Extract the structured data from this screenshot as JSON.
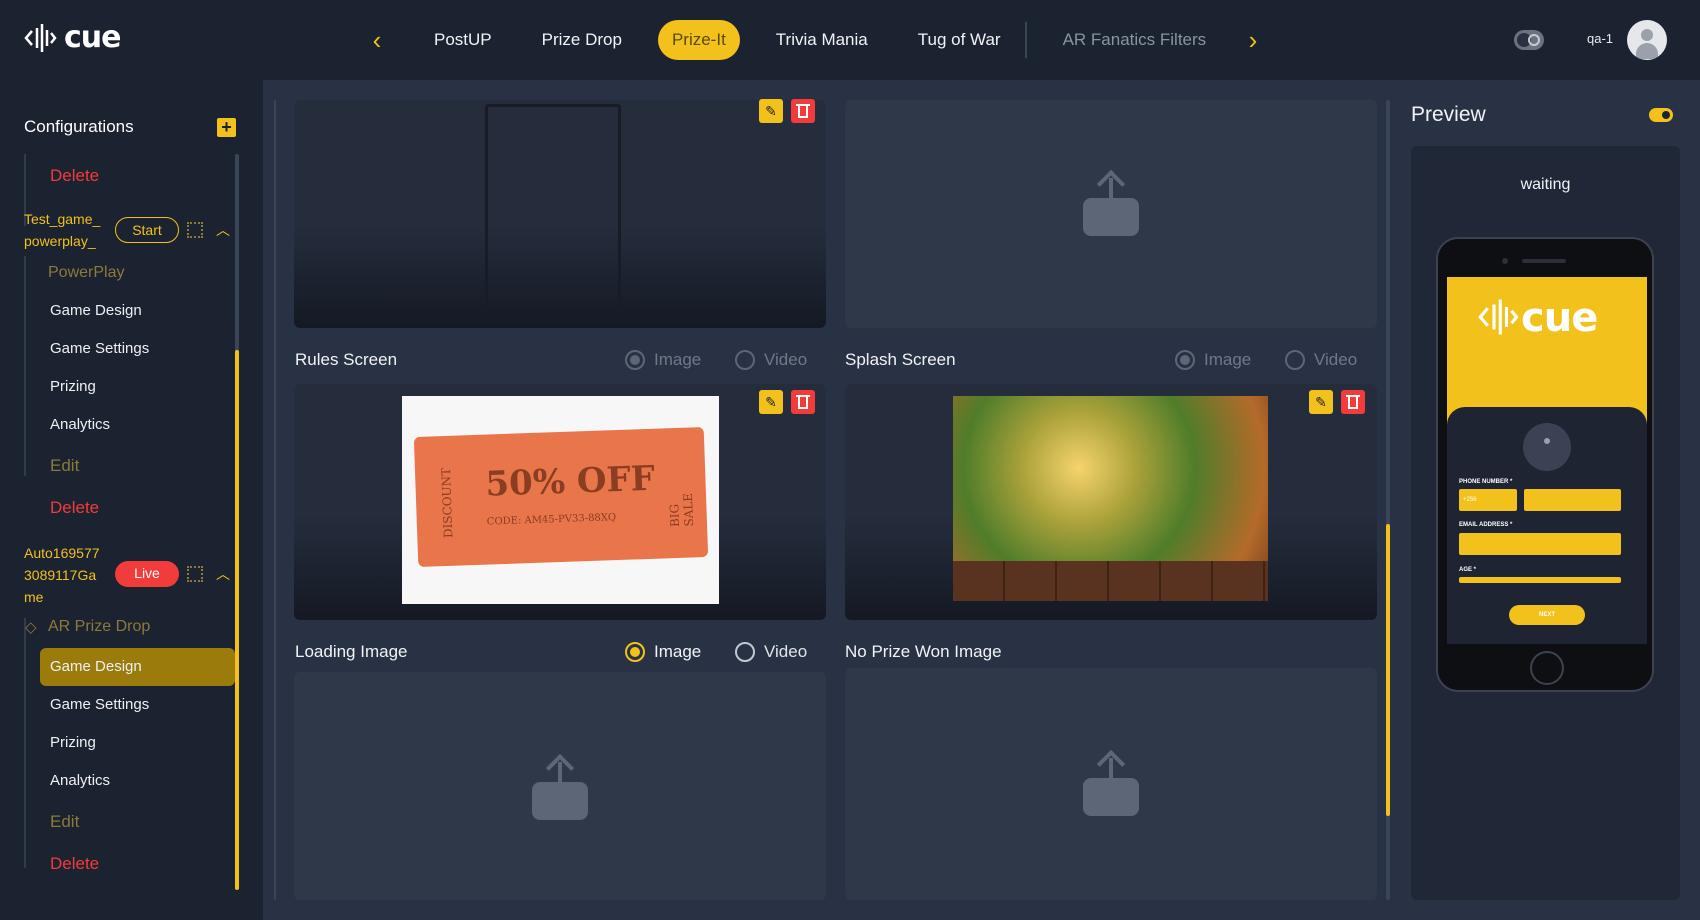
{
  "header": {
    "logo_text": "cue",
    "tabs": [
      {
        "label": "PostUP",
        "state": "normal"
      },
      {
        "label": "Prize Drop",
        "state": "normal"
      },
      {
        "label": "Prize-It",
        "state": "active"
      },
      {
        "label": "Trivia Mania",
        "state": "normal"
      },
      {
        "label": "Tug of War",
        "state": "normal"
      },
      {
        "label": "AR Fanatics Filters",
        "state": "dim"
      }
    ],
    "username": "qa-1"
  },
  "sidebar": {
    "title": "Configurations",
    "add_label": "+",
    "top_delete": "Delete",
    "games": [
      {
        "name": "Test_game_ powerplay_",
        "badge": "Start",
        "type": "PowerPlay",
        "items": [
          "Game Design",
          "Game Settings",
          "Prizing",
          "Analytics"
        ],
        "edit": "Edit",
        "delete": "Delete"
      },
      {
        "name": "Auto169577 3089117Ga me",
        "badge": "Live",
        "type": "AR Prize Drop",
        "items": [
          "Game Design",
          "Game Settings",
          "Prizing",
          "Analytics"
        ],
        "active_item": "Game Design",
        "edit": "Edit",
        "delete": "Delete"
      }
    ]
  },
  "main": {
    "sections": [
      {
        "label": "Rules Screen",
        "options": [
          "Image",
          "Video"
        ],
        "selected": "Image"
      },
      {
        "label": "Splash Screen",
        "options": [
          "Image",
          "Video"
        ],
        "selected": "Image"
      },
      {
        "label": "Loading Image",
        "options": [
          "Image",
          "Video"
        ],
        "selected": "Image"
      },
      {
        "label": "No Prize Won Image"
      }
    ],
    "ticket": {
      "main": "50% OFF",
      "code": "CODE: AM45-PV33-88XQ",
      "left": "DISCOUNT",
      "right": "BIG SALE"
    }
  },
  "preview": {
    "title": "Preview",
    "status": "waiting",
    "phone": {
      "logo": "cue",
      "phone_label": "PHONE NUMBER *",
      "country_code": "+256",
      "email_label": "EMAIL ADDRESS *",
      "age_label": "AGE *",
      "next_label": "NEXT"
    }
  },
  "colors": {
    "accent": "#f2c11c",
    "danger": "#f23b3b",
    "background": "#1b2230",
    "panel": "#293244"
  }
}
